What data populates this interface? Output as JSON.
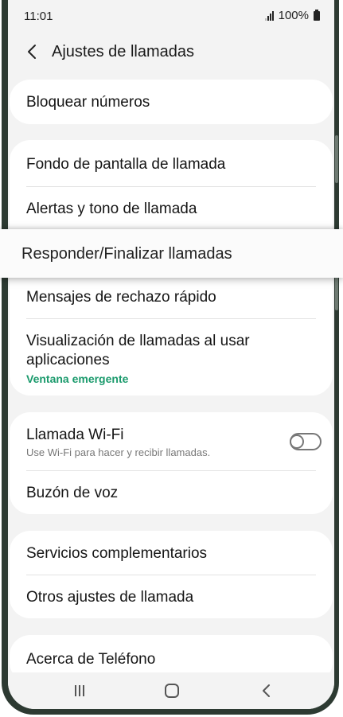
{
  "status_bar": {
    "time": "11:01",
    "battery": "100%",
    "signal_icon": "signal-icon",
    "battery_icon": "battery-icon"
  },
  "header": {
    "title": "Ajustes de llamadas",
    "back_icon": "back-arrow-icon"
  },
  "sections": {
    "block": {
      "label": "Bloquear números"
    },
    "call_wallpaper": {
      "label": "Fondo de pantalla de llamada"
    },
    "alerts_ringtone": {
      "label": "Alertas y tono de llamada"
    },
    "answer_end": {
      "label": "Responder/Finalizar llamadas"
    },
    "quick_decline": {
      "label": "Mensajes de rechazo rápido"
    },
    "call_display": {
      "label": "Visualización de llamadas al usar aplicaciones",
      "value": "Ventana emergente"
    },
    "wifi_calling": {
      "label": "Llamada Wi-Fi",
      "subtitle": "Use Wi-Fi para hacer y recibir llamadas.",
      "enabled": false
    },
    "voicemail": {
      "label": "Buzón de voz"
    },
    "supplementary": {
      "label": "Servicios complementarios"
    },
    "other_settings": {
      "label": "Otros ajustes de llamada"
    },
    "about_phone": {
      "label": "Acerca de Teléfono"
    }
  },
  "navbar": {
    "recent_icon": "recent-apps-icon",
    "home_icon": "home-icon",
    "back_icon": "nav-back-icon"
  },
  "colors": {
    "accent": "#1a9a6c",
    "background": "#f3f3f3",
    "card": "#ffffff",
    "frame": "#2d3a32"
  }
}
